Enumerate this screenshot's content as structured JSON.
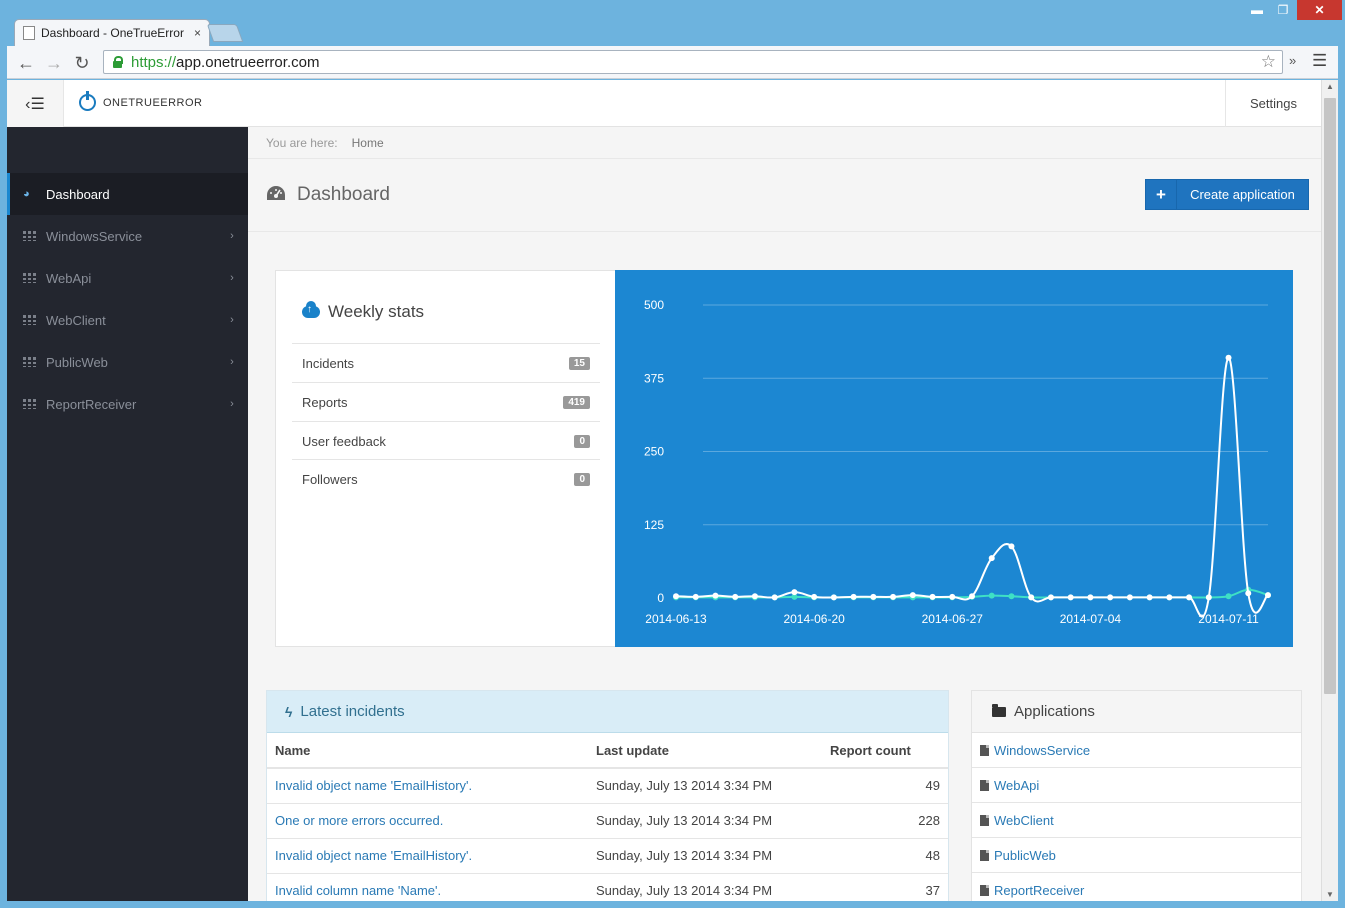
{
  "browser": {
    "tab_title": "Dashboard - OneTrueError",
    "tab_close": "×",
    "url_scheme": "https://",
    "url_host": "app.onetrueerror.com",
    "win_min": "▬",
    "win_max": "❐",
    "win_close": "✕"
  },
  "topbar": {
    "brand": "ONETRUEERROR",
    "settings": "Settings"
  },
  "sidebar": {
    "items": [
      {
        "label": "Dashboard"
      },
      {
        "label": "WindowsService"
      },
      {
        "label": "WebApi"
      },
      {
        "label": "WebClient"
      },
      {
        "label": "PublicWeb"
      },
      {
        "label": "ReportReceiver"
      }
    ]
  },
  "breadcrumb": {
    "prefix": "You are here:",
    "current": "Home"
  },
  "page": {
    "title": "Dashboard",
    "create_button": "Create application"
  },
  "weekly_stats": {
    "title": "Weekly stats",
    "rows": [
      {
        "label": "Incidents",
        "value": "15"
      },
      {
        "label": "Reports",
        "value": "419"
      },
      {
        "label": "User feedback",
        "value": "0"
      },
      {
        "label": "Followers",
        "value": "0"
      }
    ]
  },
  "chart_data": {
    "type": "line",
    "title": "",
    "xlabel": "",
    "ylabel": "",
    "ylim": [
      0,
      500
    ],
    "yticks": [
      0,
      125,
      250,
      375,
      500
    ],
    "xtick_labels": [
      "2014-06-13",
      "2014-06-20",
      "2014-06-27",
      "2014-07-04",
      "2014-07-11"
    ],
    "x": [
      "2014-06-13",
      "2014-06-14",
      "2014-06-15",
      "2014-06-16",
      "2014-06-17",
      "2014-06-18",
      "2014-06-19",
      "2014-06-20",
      "2014-06-21",
      "2014-06-22",
      "2014-06-23",
      "2014-06-24",
      "2014-06-25",
      "2014-06-26",
      "2014-06-27",
      "2014-06-28",
      "2014-06-29",
      "2014-06-30",
      "2014-07-01",
      "2014-07-02",
      "2014-07-03",
      "2014-07-04",
      "2014-07-05",
      "2014-07-06",
      "2014-07-07",
      "2014-07-08",
      "2014-07-09",
      "2014-07-10",
      "2014-07-11",
      "2014-07-12",
      "2014-07-13"
    ],
    "series": [
      {
        "values": [
          3,
          2,
          4,
          2,
          3,
          1,
          10,
          2,
          1,
          2,
          2,
          2,
          5,
          2,
          2,
          3,
          68,
          88,
          1,
          1,
          1,
          1,
          1,
          1,
          1,
          1,
          1,
          1,
          410,
          8,
          5
        ],
        "color": "#ffffff"
      },
      {
        "values": [
          1,
          1,
          1,
          1,
          1,
          1,
          2,
          1,
          1,
          1,
          1,
          1,
          1,
          1,
          1,
          2,
          4,
          3,
          1,
          1,
          1,
          1,
          1,
          1,
          1,
          1,
          1,
          1,
          3,
          14,
          5
        ],
        "color": "#3ee0c5"
      }
    ],
    "grid": true
  },
  "incidents": {
    "title": "Latest incidents",
    "columns": [
      "Name",
      "Last update",
      "Report count"
    ],
    "rows": [
      {
        "name": "Invalid object name 'EmailHistory'.",
        "updated": "Sunday, July 13 2014 3:34 PM",
        "count": "49"
      },
      {
        "name": "One or more errors occurred.",
        "updated": "Sunday, July 13 2014 3:34 PM",
        "count": "228"
      },
      {
        "name": "Invalid object name 'EmailHistory'.",
        "updated": "Sunday, July 13 2014 3:34 PM",
        "count": "48"
      },
      {
        "name": "Invalid column name 'Name'.",
        "updated": "Sunday, July 13 2014 3:34 PM",
        "count": "37"
      }
    ]
  },
  "applications": {
    "title": "Applications",
    "items": [
      "WindowsService",
      "WebApi",
      "WebClient",
      "PublicWeb",
      "ReportReceiver"
    ]
  }
}
